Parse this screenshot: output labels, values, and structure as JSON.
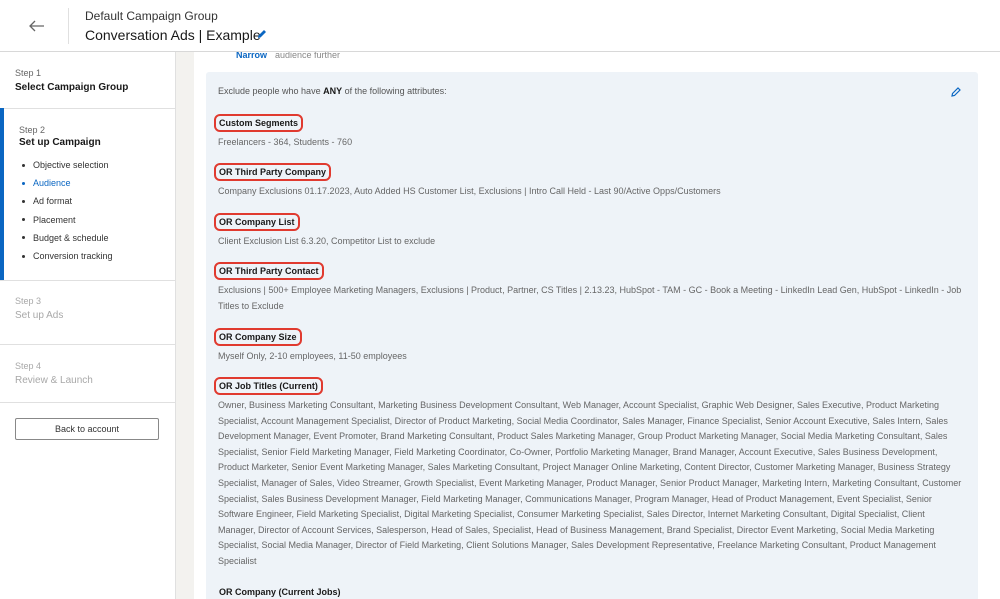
{
  "header": {
    "group_name": "Default Campaign Group",
    "campaign_name": "Conversation Ads | Example"
  },
  "sidebar": {
    "step1": {
      "num": "Step 1",
      "title": "Select Campaign Group"
    },
    "step2": {
      "num": "Step 2",
      "title": "Set up Campaign",
      "items": [
        {
          "label": "Objective selection"
        },
        {
          "label": "Audience"
        },
        {
          "label": "Ad format"
        },
        {
          "label": "Placement"
        },
        {
          "label": "Budget & schedule"
        },
        {
          "label": "Conversion tracking"
        }
      ]
    },
    "step3": {
      "num": "Step 3",
      "title": "Set up Ads"
    },
    "step4": {
      "num": "Step 4",
      "title": "Review & Launch"
    },
    "back_label": "Back to account"
  },
  "main": {
    "narrow_link": "Narrow",
    "narrow_text": "audience further",
    "exclude": {
      "prefix": "Exclude people who have ",
      "emphasis": "ANY",
      "suffix": " of the following attributes:",
      "attributes": [
        {
          "label": "Custom Segments",
          "values": "Freelancers - 364, Students - 760"
        },
        {
          "label": "OR Third Party Company",
          "values": "Company Exclusions 01.17.2023, Auto Added HS Customer List, Exclusions | Intro Call Held - Last 90/Active Opps/Customers"
        },
        {
          "label": "OR Company List",
          "values": "Client Exclusion List 6.3.20, Competitor List to exclude"
        },
        {
          "label": "OR Third Party Contact",
          "values": "Exclusions | 500+ Employee Marketing Managers, Exclusions | Product, Partner, CS Titles | 2.13.23, HubSpot - TAM - GC - Book a Meeting - LinkedIn Lead Gen, HubSpot - LinkedIn - Job Titles to Exclude"
        },
        {
          "label": "OR Company Size",
          "values": "Myself Only, 2-10 employees, 11-50 employees"
        },
        {
          "label": "OR Job Titles (Current)",
          "values": "Owner, Business Marketing Consultant, Marketing Business Development Consultant, Web Manager, Account Specialist, Graphic Web Designer, Sales Executive, Product Marketing Specialist, Account Management Specialist, Director of Product Marketing, Social Media Coordinator, Sales Manager, Finance Specialist, Senior Account Executive, Sales Intern, Sales Development Manager, Event Promoter, Brand Marketing Consultant, Product Sales Marketing Manager, Group Product Marketing Manager, Social Media Marketing Consultant, Sales Specialist, Senior Field Marketing Manager, Field Marketing Coordinator, Co-Owner, Portfolio Marketing Manager, Brand Manager, Account Executive, Sales Business Development, Product Marketer, Senior Event Marketing Manager, Sales Marketing Consultant, Project Manager Online Marketing, Content Director, Customer Marketing Manager, Business Strategy Specialist, Manager of Sales, Video Streamer, Growth Specialist, Event Marketing Manager, Product Manager, Senior Product Manager, Marketing Intern, Marketing Consultant, Customer Specialist, Sales Business Development Manager, Field Marketing Manager, Communications Manager, Program Manager, Head of Product Management, Event Specialist, Senior Software Engineer, Field Marketing Specialist, Digital Marketing Specialist, Consumer Marketing Specialist, Sales Director, Internet Marketing Consultant, Digital Specialist, Client Manager, Director of Account Services, Salesperson, Head of Sales, Specialist, Head of Business Management, Brand Specialist, Director Event Marketing, Social Media Marketing Specialist, Social Media Manager, Director of Field Marketing, Client Solutions Manager, Sales Development Representative, Freelance Marketing Consultant, Product Management Specialist"
        },
        {
          "label": "OR Company (Current Jobs)",
          "values": ""
        }
      ]
    }
  }
}
